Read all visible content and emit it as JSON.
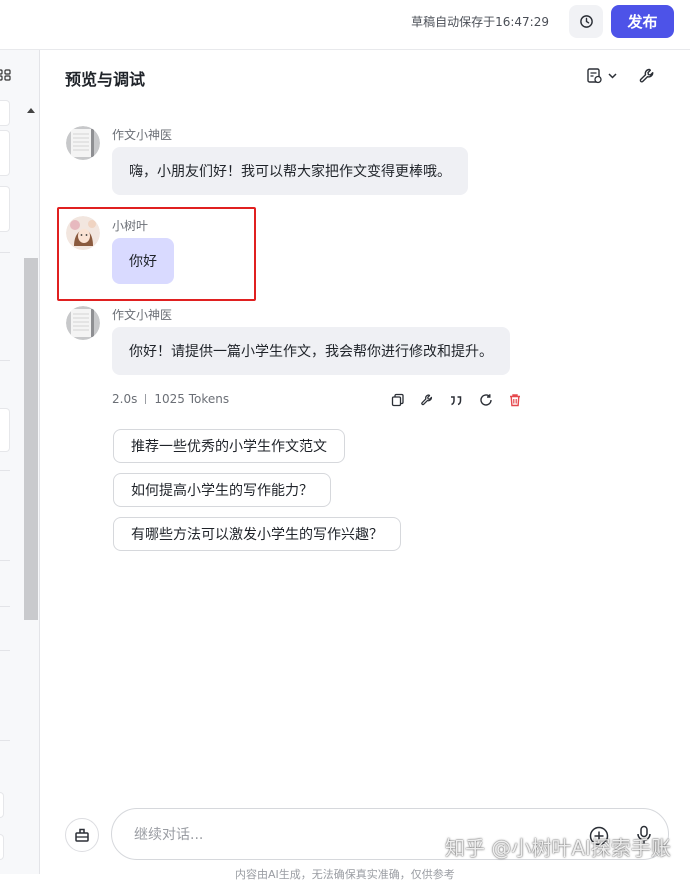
{
  "header": {
    "autosave_text": "草稿自动保存于16:47:29",
    "publish_label": "发布"
  },
  "main": {
    "title": "预览与调试"
  },
  "messages": [
    {
      "role": "bot",
      "sender": "作文小神医",
      "text": "嗨，小朋友们好！我可以帮大家把作文变得更棒哦。"
    },
    {
      "role": "user",
      "sender": "小树叶",
      "text": "你好"
    },
    {
      "role": "bot",
      "sender": "作文小神医",
      "text": "你好！请提供一篇小学生作文，我会帮你进行修改和提升。"
    }
  ],
  "response_meta": {
    "time": "2.0s",
    "tokens": "1025 Tokens"
  },
  "suggestions": [
    "推荐一些优秀的小学生作文范文",
    "如何提高小学生的写作能力？",
    "有哪些方法可以激发小学生的写作兴趣？"
  ],
  "input": {
    "placeholder": "继续对话..."
  },
  "footer": {
    "disclaimer": "内容由AI生成，无法确保真实准确，仅供参考"
  },
  "watermark": "知乎 @小树叶AI探索手账",
  "icons": {
    "history": "history-icon",
    "settings": "settings-dropdown-icon",
    "debug": "wrench-icon",
    "copy": "copy-icon",
    "quote": "quote-icon",
    "regenerate": "refresh-icon",
    "delete": "delete-icon",
    "plus": "plus-circle-icon",
    "mic": "microphone-icon",
    "clear": "clear-history-icon"
  },
  "colors": {
    "accent": "#4d53e8",
    "user_bubble": "#d9daff",
    "bot_bubble": "#eff0f4",
    "highlight": "#e02020",
    "delete": "#e5484d"
  }
}
